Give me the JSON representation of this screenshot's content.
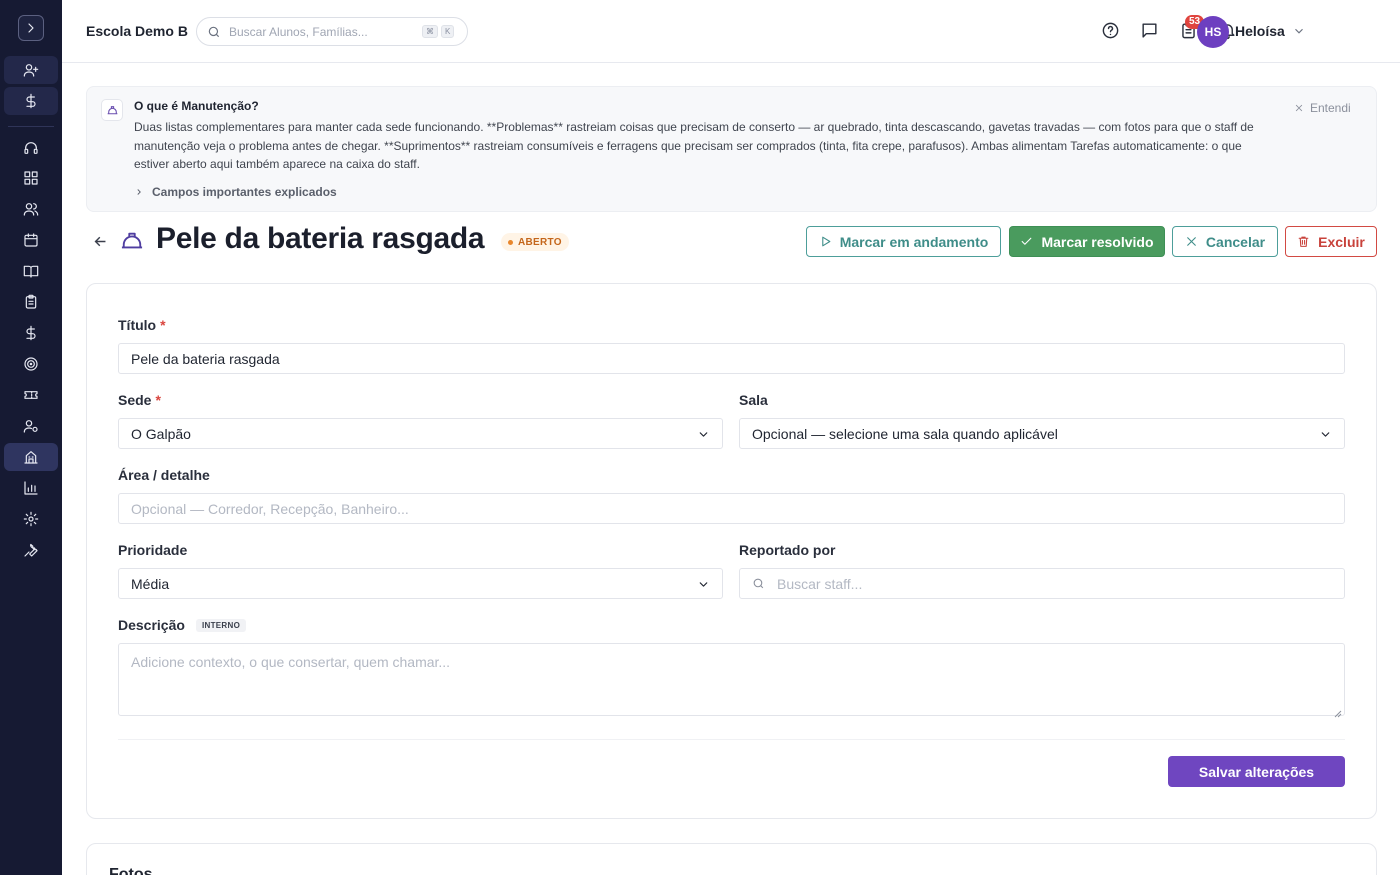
{
  "sidebar": {
    "items": [
      {
        "icon": "user-plus-icon"
      },
      {
        "icon": "dollar-icon"
      },
      {
        "icon": "headset-icon"
      },
      {
        "icon": "dashboard-icon"
      },
      {
        "icon": "users-icon"
      },
      {
        "icon": "calendar-icon"
      },
      {
        "icon": "book-icon"
      },
      {
        "icon": "clipboard-icon"
      },
      {
        "icon": "dollar-icon"
      },
      {
        "icon": "target-icon"
      },
      {
        "icon": "ticket-icon"
      },
      {
        "icon": "user-gear-icon"
      },
      {
        "icon": "building-icon"
      },
      {
        "icon": "bar-chart-icon"
      },
      {
        "icon": "gear-icon"
      },
      {
        "icon": "wrench-icon"
      }
    ],
    "active_item": "building-icon"
  },
  "header": {
    "school_name": "Escola Demo B",
    "search_placeholder": "Buscar Alunos, Famílias...",
    "shortcut_keys": [
      "⌘",
      "K"
    ],
    "notification_count": "53",
    "user_initials": "HS",
    "user_name": "Heloísa"
  },
  "banner": {
    "title": "O que é Manutenção?",
    "text": "Duas listas complementares para manter cada sede funcionando. **Problemas** rastreiam coisas que precisam de conserto — ar quebrado, tinta descascando, gavetas travadas — com fotos para que o staff de manutenção veja o problema antes de chegar. **Suprimentos** rastreiam consumíveis e ferragens que precisam ser comprados (tinta, fita crepe, parafusos). Ambas alimentam Tarefas automaticamente: o que estiver aberto aqui também aparece na caixa do staff.",
    "dismiss_label": "Entendi",
    "fields_toggle": "Campos importantes explicados"
  },
  "page": {
    "title": "Pele da bateria rasgada",
    "status": "ABERTO",
    "status_color": "#e8862c",
    "actions": {
      "in_progress": "Marcar em andamento",
      "resolve": "Marcar resolvido",
      "cancel": "Cancelar",
      "delete": "Excluir"
    }
  },
  "form": {
    "title_label": "Título",
    "title_value": "Pele da bateria rasgada",
    "site_label": "Sede",
    "site_value": "O Galpão",
    "room_label": "Sala",
    "room_value": "Opcional — selecione uma sala quando aplicável",
    "area_label": "Área / detalhe",
    "area_placeholder": "Opcional — Corredor, Recepção, Banheiro...",
    "priority_label": "Prioridade",
    "priority_value": "Média",
    "reported_by_label": "Reportado por",
    "reported_by_placeholder": "Buscar staff...",
    "description_label": "Descrição",
    "description_tag": "INTERNO",
    "description_placeholder": "Adicione contexto, o que consertar, quem chamar...",
    "save_label": "Salvar alterações"
  },
  "photos": {
    "title": "Fotos"
  },
  "colors": {
    "sidebar_bg": "#161a33",
    "primary": "#6f46c0",
    "success": "#4a9b5e",
    "teal": "#3f8d89",
    "danger": "#c8423b"
  }
}
